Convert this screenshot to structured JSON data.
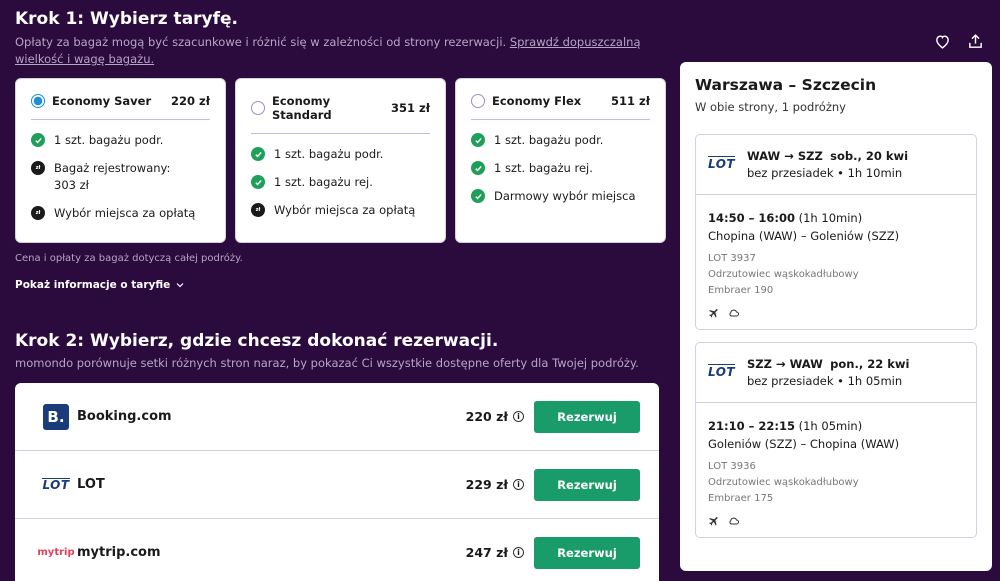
{
  "step1": {
    "title": "Krok 1: Wybierz taryfę.",
    "description": "Opłaty za bagaż mogą być szacunkowe i różnić się w zależności od strony rezerwacji.",
    "link": "Sprawdź dopuszczalną wielkość i wagę bagażu.",
    "note": "Cena i opłaty za bagaż dotyczą całej podróży.",
    "info_link": "Pokaż informacje o taryfie"
  },
  "tariffs": [
    {
      "name": "Economy Saver",
      "price": "220 zł",
      "selected": true,
      "features": [
        {
          "icon": "check",
          "text": "1 szt. bagażu podr."
        },
        {
          "icon": "paid",
          "text": "Bagaż rejestrowany: 303 zł"
        },
        {
          "icon": "paid",
          "text": "Wybór miejsca za opłatą"
        }
      ]
    },
    {
      "name": "Economy Standard",
      "price": "351 zł",
      "selected": false,
      "features": [
        {
          "icon": "check",
          "text": "1 szt. bagażu podr."
        },
        {
          "icon": "check",
          "text": "1 szt. bagażu rej."
        },
        {
          "icon": "paid",
          "text": "Wybór miejsca za opłatą"
        }
      ]
    },
    {
      "name": "Economy Flex",
      "price": "511 zł",
      "selected": false,
      "features": [
        {
          "icon": "check",
          "text": "1 szt. bagażu podr."
        },
        {
          "icon": "check",
          "text": "1 szt. bagażu rej."
        },
        {
          "icon": "check",
          "text": "Darmowy wybór miejsca"
        }
      ]
    }
  ],
  "paid_icon_text": "zł",
  "step2": {
    "title": "Krok 2: Wybierz, gdzie chcesz dokonać rezerwacji.",
    "description": "momondo porównuje setki różnych stron naraz, by pokazać Ci wszystkie dostępne oferty dla Twojej podróży."
  },
  "providers": [
    {
      "name": "Booking.com",
      "price": "220 zł",
      "logo": "B.",
      "button": "Rezerwuj"
    },
    {
      "name": "LOT",
      "price": "229 zł",
      "logo": "LOT",
      "button": "Rezerwuj"
    },
    {
      "name": "mytrip.com",
      "price": "247 zł",
      "logo": "mytrip",
      "button": "Rezerwuj"
    }
  ],
  "info_icon": "i",
  "summary": {
    "route": "Warszawa – Szczecin",
    "sub": "W obie strony, 1 podróżny",
    "legs": [
      {
        "route": "WAW → SZZ",
        "date": "sob., 20 kwi",
        "stops": "bez przesiadek • 1h 10min",
        "times": "14:50 – 16:00",
        "duration": "(1h 10min)",
        "airports": "Chopina (WAW) – Goleniów (SZZ)",
        "flight": "LOT 3937",
        "aircraft_type": "Odrzutowiec wąskokadłubowy",
        "aircraft": "Embraer 190",
        "logo": "LOT"
      },
      {
        "route": "SZZ → WAW",
        "date": "pon., 22 kwi",
        "stops": "bez przesiadek • 1h 05min",
        "times": "21:10 – 22:15",
        "duration": "(1h 05min)",
        "airports": "Goleniów (SZZ) – Chopina (WAW)",
        "flight": "LOT 3936",
        "aircraft_type": "Odrzutowiec wąskokadłubowy",
        "aircraft": "Embraer 175",
        "logo": "LOT"
      }
    ]
  },
  "colors": {
    "background": "#2b0a3d",
    "accent_green": "#1a9b6a",
    "radio_blue": "#1a8fd9"
  }
}
